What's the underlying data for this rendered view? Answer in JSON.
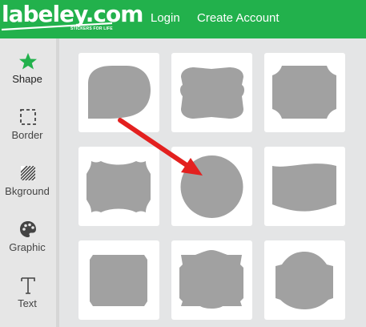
{
  "header": {
    "logo_text": "labeley.com",
    "logo_tagline": "STICKERS FOR LIFE",
    "nav": [
      {
        "label": "Login"
      },
      {
        "label": "Create Account"
      }
    ],
    "brand_color": "#22b14c"
  },
  "sidebar": {
    "items": [
      {
        "label": "Shape",
        "icon": "star-icon",
        "active": true
      },
      {
        "label": "Border",
        "icon": "dashed-square-icon"
      },
      {
        "label": "Bkground",
        "icon": "hatched-square-icon"
      },
      {
        "label": "Graphic",
        "icon": "palette-icon"
      },
      {
        "label": "Text",
        "icon": "text-t-icon"
      }
    ]
  },
  "shapes": {
    "fill_color": "#a1a1a1",
    "items": [
      {
        "name": "speech-bubble-shape"
      },
      {
        "name": "wavy-rectangle-shape"
      },
      {
        "name": "notched-rectangle-shape"
      },
      {
        "name": "scalloped-frame-shape"
      },
      {
        "name": "circle-shape"
      },
      {
        "name": "wave-banner-shape"
      },
      {
        "name": "beveled-rectangle-shape"
      },
      {
        "name": "ornate-frame-shape"
      },
      {
        "name": "arched-plaque-shape"
      }
    ]
  },
  "annotation": {
    "arrow_color": "#e3201f"
  }
}
